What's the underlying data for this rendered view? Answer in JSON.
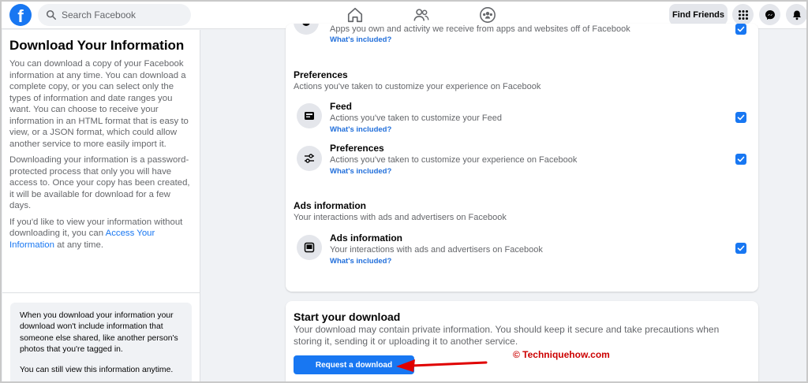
{
  "topbar": {
    "logo_letter": "f",
    "search_placeholder": "Search Facebook",
    "find_friends_label": "Find Friends"
  },
  "left_panel": {
    "title": "Download Your Information",
    "para1": "You can download a copy of your Facebook information at any time. You can download a complete copy, or you can select only the types of information and date ranges you want. You can choose to receive your information in an HTML format that is easy to view, or a JSON format, which could allow another service to more easily import it.",
    "para2": "Downloading your information is a password-protected process that only you will have access to. Once your copy has been created, it will be available for download for a few days.",
    "para3_pre": "If you'd like to view your information without downloading it, you can ",
    "para3_link": "Access Your Information",
    "para3_post": " at any time.",
    "note1": "When you download your information your download won't include information that someone else shared, like another person's photos that you're tagged in.",
    "note2": "You can still view this information anytime."
  },
  "categories": {
    "top_partial": {
      "subtitle": "Apps you own and activity we receive from apps and websites off of Facebook",
      "link": "What's included?"
    },
    "preferences_section": {
      "title": "Preferences",
      "subtitle": "Actions you've taken to customize your experience on Facebook"
    },
    "feed": {
      "title": "Feed",
      "subtitle": "Actions you've taken to customize your Feed",
      "link": "What's included?"
    },
    "preferences_item": {
      "title": "Preferences",
      "subtitle": "Actions you've taken to customize your experience on Facebook",
      "link": "What's included?"
    },
    "ads_section": {
      "title": "Ads information",
      "subtitle": "Your interactions with ads and advertisers on Facebook"
    },
    "ads_item": {
      "title": "Ads information",
      "subtitle": "Your interactions with ads and advertisers on Facebook",
      "link": "What's included?"
    }
  },
  "download": {
    "title": "Start your download",
    "description": "Your download may contain private information. You should keep it secure and take precautions when storing it, sending it or uploading it to another service.",
    "button_label": "Request a download"
  },
  "watermark": "© Techniquehow.com",
  "colors": {
    "brand_blue": "#1877f2",
    "link_blue": "#216fdb",
    "watermark_red": "#cc0000",
    "page_bg": "#f0f2f5"
  }
}
